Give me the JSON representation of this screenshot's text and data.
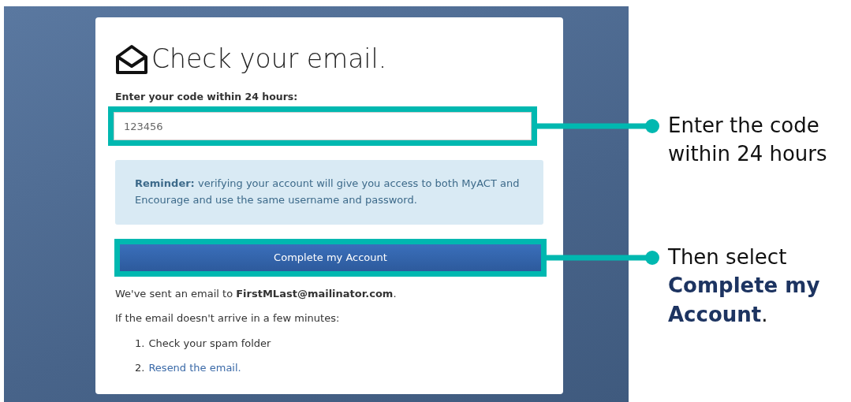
{
  "card": {
    "heading": "Check your email.",
    "code_label": "Enter your code within 24 hours:",
    "code_field": {
      "value": "123456"
    },
    "reminder": "**Reminder:** verifying your account will give you access to both MyACT and Encourage and use the same username and password.",
    "button": "Complete my Account",
    "sent_notice": "We've sent an email to **FirstMLast@mailinator.com**.",
    "help_intro": "If the email doesn't arrive in a few minutes:",
    "steps": [
      {
        "number": "1.",
        "text": "Check your spam folder",
        "kind": "text"
      },
      {
        "number": "2.",
        "text": "Resend the email.",
        "kind": "link"
      }
    ]
  },
  "annotations": [
    {
      "text": "Enter the code within 24 hours"
    },
    {
      "text": "Then select **Complete my Account**."
    }
  ]
}
